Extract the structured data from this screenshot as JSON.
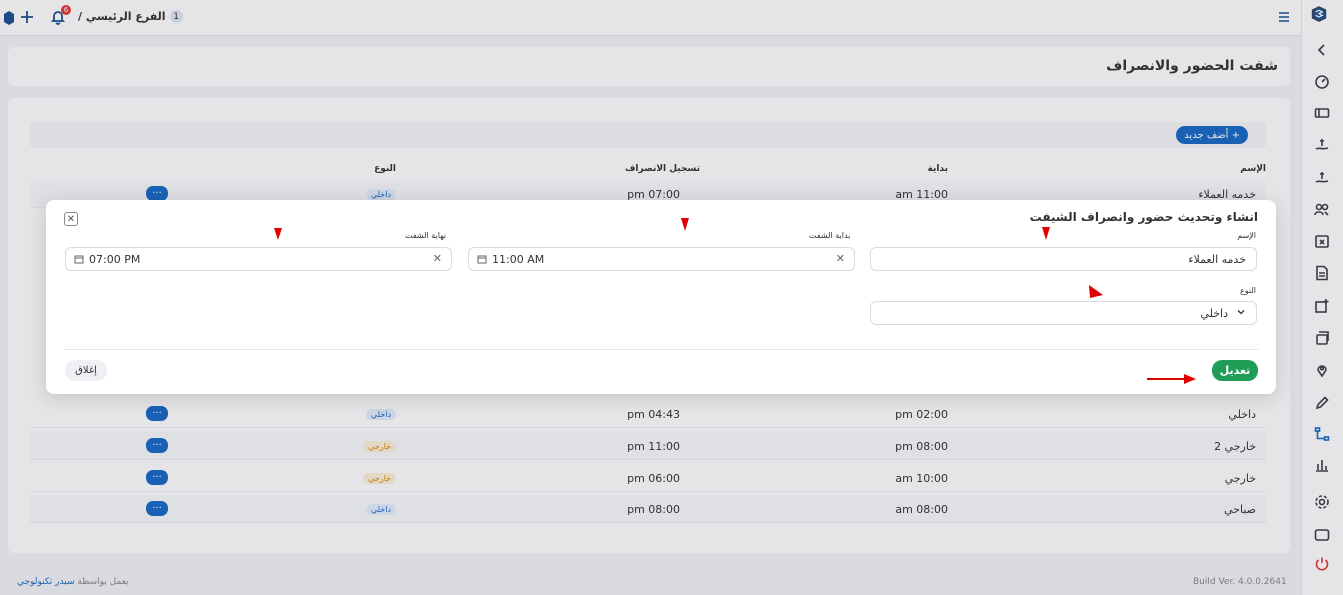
{
  "topbar": {
    "branch_number": "1",
    "branch_label": "الفرع الرئيسي /",
    "notification_count": "6"
  },
  "page": {
    "title": "شفت الحضور والانصراف"
  },
  "toolbar": {
    "add_label": "+ أضف جديد"
  },
  "table": {
    "headers": {
      "name": "الإسم",
      "start": "بداية",
      "checkout": "تسجيل الانصراف",
      "type": "النوع"
    },
    "rows": [
      {
        "name": "خدمه العملاء",
        "start": "am 11:00",
        "end": "pm 07:00",
        "type": "داخلي",
        "type_kind": "in",
        "action": "···"
      },
      {
        "name": "داخلي",
        "start": "pm 02:00",
        "end": "pm 04:43",
        "type": "داخلي",
        "type_kind": "in",
        "action": "···"
      },
      {
        "name": "خارجي 2",
        "start": "pm 08:00",
        "end": "pm 11:00",
        "type": "خارجي",
        "type_kind": "out",
        "action": "···"
      },
      {
        "name": "خارجي",
        "start": "am 10:00",
        "end": "pm 06:00",
        "type": "خارجي",
        "type_kind": "out",
        "action": "···"
      },
      {
        "name": "صباحي",
        "start": "am 08:00",
        "end": "pm 08:00",
        "type": "داخلي",
        "type_kind": "in",
        "action": "···"
      }
    ]
  },
  "modal": {
    "title": "انشاء وتحديث حضور وانصراف الشيفت",
    "close_icon_label": "✕",
    "name_label": "الإسم",
    "name_value": "خدمه العملاء",
    "start_label": "بداية الشفت",
    "start_value": "11:00 AM",
    "end_label": "نهاية الشفت",
    "end_value": "07:00 PM",
    "type_label": "النوع",
    "type_value": "داخلي",
    "edit_button": "تعديل",
    "close_button": "إغلاق"
  },
  "footer": {
    "powered_prefix": "يعمل بواسطة",
    "powered_brand": "سيدر تكنولوجي",
    "build": "Build Ver. 4.0.0.2641"
  },
  "colors": {
    "primary": "#1769c7",
    "success": "#1f9d57",
    "danger": "#e53935",
    "annotation_red": "#e00000"
  },
  "icons": {
    "rail": [
      "logo-icon",
      "chevron-left-icon",
      "dashboard-icon",
      "ticket-icon",
      "money-hand-icon",
      "money-hand-2-icon",
      "users-settings-icon",
      "calendar-x-icon",
      "document-icon",
      "add-box-icon",
      "cards-icon",
      "location-pin-icon",
      "pen-icon",
      "hierarchy-icon",
      "bar-chart-icon",
      "gear-icon",
      "monitor-icon",
      "power-icon"
    ]
  }
}
